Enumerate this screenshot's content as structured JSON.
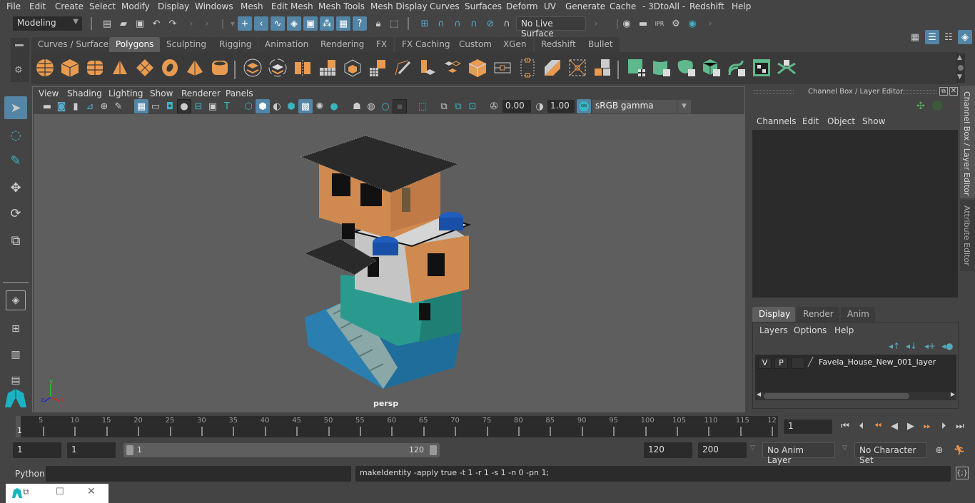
{
  "menubar": {
    "items": [
      "File",
      "Edit",
      "Create",
      "Select",
      "Modify",
      "Display",
      "Windows",
      "Mesh",
      "Edit Mesh",
      "Mesh Tools",
      "Mesh Display",
      "Curves",
      "Surfaces",
      "Deform",
      "UV",
      "Generate",
      "Cache",
      "- 3DtoAll -",
      "Redshift",
      "Help"
    ]
  },
  "statusline": {
    "workspace": "Modeling",
    "live_surface": "No Live Surface",
    "file_icons": [
      "new-scene-icon",
      "open-scene-icon",
      "save-scene-icon",
      "undo-icon",
      "redo-icon"
    ],
    "selection_mask_icons": [
      "select-handles-icon",
      "select-joints-icon",
      "select-curves-icon",
      "select-surfaces-icon",
      "select-deformations-icon",
      "select-dynamics-icon",
      "select-rendering-icon",
      "select-misc-icon"
    ],
    "snap_icons": [
      "snap-grid-icon",
      "snap-curve-icon",
      "snap-point-icon",
      "snap-view-plane-icon",
      "snap-live-icon",
      "make-live-icon"
    ],
    "render_icons": [
      "render-view-icon",
      "render-current-icon",
      "ipr-render-icon",
      "render-settings-icon",
      "hypershade-icon"
    ],
    "right_icons": [
      "modeling-toolkit-icon",
      "attribute-editor-icon",
      "tool-settings-icon",
      "channel-box-icon"
    ]
  },
  "shelf": {
    "tabs": [
      "Curves / Surfaces",
      "Polygons",
      "Sculpting",
      "Rigging",
      "Animation",
      "Rendering",
      "FX",
      "FX Caching",
      "Custom",
      "XGen",
      "Redshift",
      "Bullet"
    ],
    "active_tab": "Polygons",
    "icons": [
      "poly-sphere-icon",
      "poly-cube-icon",
      "poly-cylinder-icon",
      "poly-cone-icon",
      "poly-plane-icon",
      "poly-torus-icon",
      "poly-pyramid-icon",
      "poly-pipe-icon",
      "combine-icon",
      "separate-icon",
      "extract-icon",
      "smooth-icon",
      "mirror-icon",
      "boolean-icon",
      "multi-cut-icon",
      "extrude-icon",
      "bridge-icon",
      "bevel-icon",
      "edge-loop-icon",
      "insert-loop-icon",
      "bridge-edge-icon",
      "fill-hole-icon",
      "merge-icon",
      "uv-planar-icon",
      "uv-cylindrical-icon",
      "uv-spherical-icon",
      "uv-automatic-icon",
      "uv-unfold-icon",
      "uv-editor-icon",
      "uv-cut-sew-icon"
    ]
  },
  "viewport": {
    "menu": [
      "View",
      "Shading",
      "Lighting",
      "Show",
      "Renderer",
      "Panels"
    ],
    "exposure": "0.00",
    "gamma": "1.00",
    "color_mgmt_badge": "ON",
    "color_space": "sRGB gamma",
    "camera_label": "persp",
    "axis": {
      "x": "x",
      "y": "y",
      "z": "z"
    }
  },
  "toolbox": {
    "tools": [
      "select-tool-icon",
      "lasso-select-icon",
      "paint-select-icon",
      "move-tool-icon",
      "rotate-tool-icon",
      "scale-tool-icon"
    ],
    "layouts": [
      "single-pane-layout-icon",
      "four-pane-layout-icon",
      "outliner-persp-layout-icon",
      "persp-graph-layout-icon"
    ]
  },
  "channel_box": {
    "title": "Channel Box / Layer Editor",
    "menu": [
      "Channels",
      "Edit",
      "Object",
      "Show"
    ]
  },
  "layer_editor": {
    "tabs": [
      "Display",
      "Render",
      "Anim"
    ],
    "active_tab": "Display",
    "menu": [
      "Layers",
      "Options",
      "Help"
    ],
    "layers": [
      {
        "v": "V",
        "p": "P",
        "name": "Favela_House_New_001_layer"
      }
    ]
  },
  "side_tabs": [
    "Channel Box / Layer Editor",
    "Attribute Editor"
  ],
  "timeline": {
    "start_marker": "1",
    "ticks": [
      "5",
      "10",
      "15",
      "20",
      "25",
      "30",
      "35",
      "40",
      "45",
      "50",
      "55",
      "60",
      "65",
      "70",
      "75",
      "80",
      "85",
      "90",
      "95",
      "100",
      "105",
      "110",
      "115",
      "12"
    ],
    "current_frame": "1"
  },
  "range": {
    "start_time": "1",
    "playback_start": "1",
    "slider_start": "1",
    "slider_end": "120",
    "playback_end": "120",
    "end_time": "200",
    "anim_layer": "No Anim Layer",
    "character_set": "No Character Set"
  },
  "command": {
    "language": "Python",
    "input": "",
    "result": "makeIdentity -apply true -t 1 -r 1 -s 1 -n 0 -pn 1;"
  },
  "colors": {
    "accent_blue": "#5285a6",
    "poly_orange": "#e89b50",
    "uv_green": "#5fb98c",
    "teal": "#3ab4c0"
  }
}
